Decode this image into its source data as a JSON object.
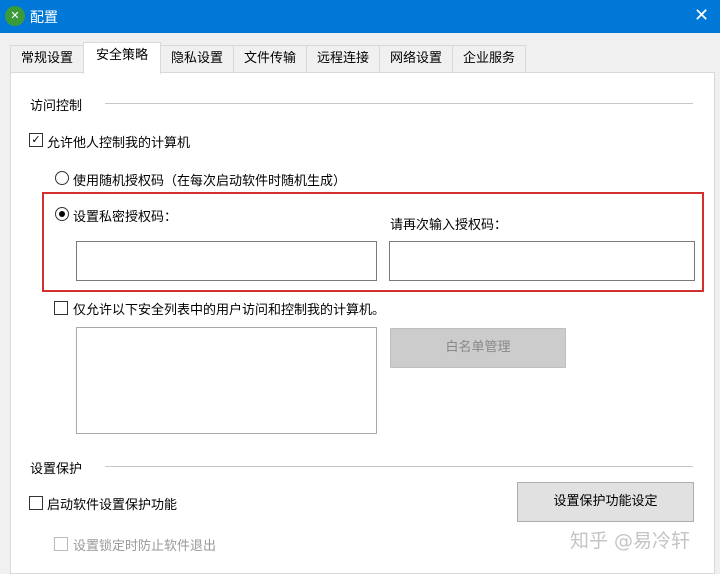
{
  "window": {
    "title": "配置",
    "close": "✕"
  },
  "tabs": [
    "常规设置",
    "安全策略",
    "隐私设置",
    "文件传输",
    "远程连接",
    "网络设置",
    "企业服务"
  ],
  "access": {
    "section": "访问控制",
    "allow_control": "允许他人控制我的计算机",
    "random_code": "使用随机授权码（在每次启动软件时随机生成）",
    "private_code": "设置私密授权码：",
    "reenter_code": "请再次输入授权码：",
    "private_value": "",
    "reenter_value": "",
    "whitelist_only": "仅允许以下安全列表中的用户访问和控制我的计算机。",
    "whitelist_button": "白名单管理",
    "highlight_color": "#d32f2f"
  },
  "protect": {
    "section": "设置保护",
    "enable": "启动软件设置保护功能",
    "settings_button": "设置保护功能设定",
    "prevent_exit": "设置锁定时防止软件退出"
  },
  "watermark": "知乎 @易冷轩"
}
